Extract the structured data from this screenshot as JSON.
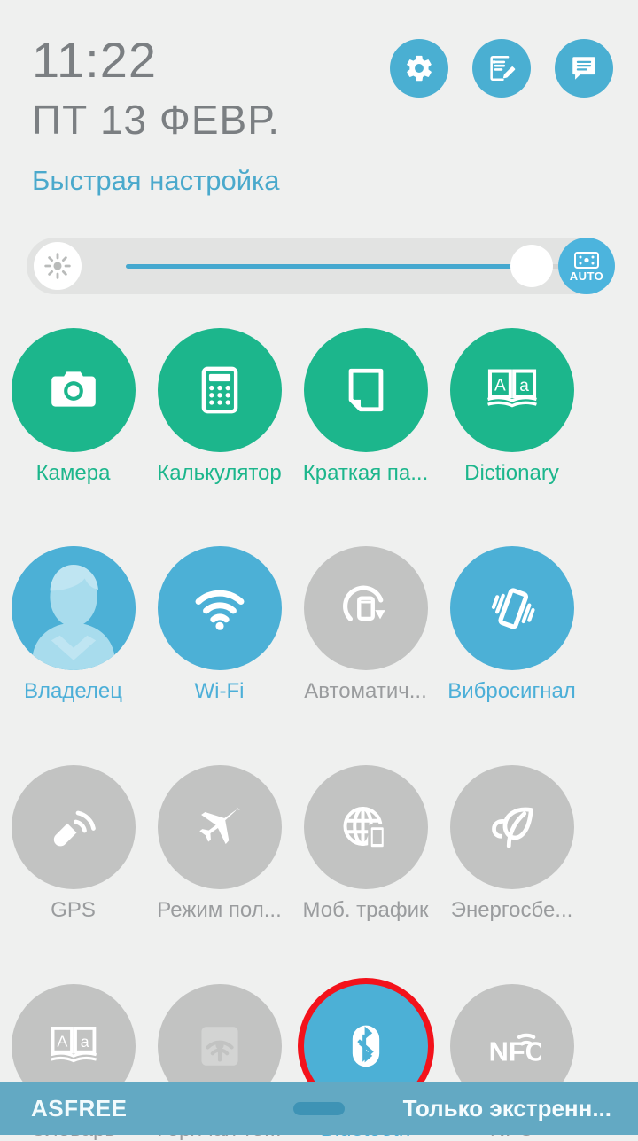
{
  "statusbar": {
    "time": "11:22",
    "date": "ПТ 13 ФЕВР.",
    "panel_title": "Быстрая настройка",
    "header_buttons": [
      {
        "name": "settings-icon",
        "label": "gear-icon"
      },
      {
        "name": "quick-note-icon",
        "label": "note-edit-icon"
      },
      {
        "name": "notifications-icon",
        "label": "chat-list-icon"
      }
    ]
  },
  "brightness": {
    "left_icon": "brightness-sun-icon",
    "value_percent": 89,
    "auto_label": "AUTO",
    "auto_icon": "light-sensor-icon",
    "auto_enabled": true
  },
  "tiles": [
    [
      {
        "label": "Камера",
        "icon": "camera-icon",
        "state": "app",
        "name": "tile-camera"
      },
      {
        "label": "Калькулятор",
        "icon": "calculator-icon",
        "state": "app",
        "name": "tile-calculator"
      },
      {
        "label": "Краткая па...",
        "icon": "quick-memo-icon",
        "state": "app",
        "name": "tile-quick-memo"
      },
      {
        "label": "Dictionary",
        "icon": "dictionary-book-icon",
        "state": "app",
        "name": "tile-dictionary-en"
      }
    ],
    [
      {
        "label": "Владелец",
        "icon": "user-avatar-icon",
        "state": "on",
        "name": "tile-owner"
      },
      {
        "label": "Wi-Fi",
        "icon": "wifi-icon",
        "state": "on",
        "name": "tile-wifi"
      },
      {
        "label": "Автоматич...",
        "icon": "auto-rotate-icon",
        "state": "off",
        "name": "tile-auto-rotate"
      },
      {
        "label": "Вибросигнал",
        "icon": "vibrate-icon",
        "state": "on",
        "name": "tile-vibrate"
      }
    ],
    [
      {
        "label": "GPS",
        "icon": "gps-satellite-icon",
        "state": "off",
        "name": "tile-gps"
      },
      {
        "label": "Режим пол...",
        "icon": "airplane-icon",
        "state": "off",
        "name": "tile-airplane-mode"
      },
      {
        "label": "Моб. трафик",
        "icon": "mobile-data-icon",
        "state": "off",
        "name": "tile-mobile-data"
      },
      {
        "label": "Энергосбе...",
        "icon": "leaf-power-saving-icon",
        "state": "off",
        "name": "tile-power-saving"
      }
    ],
    [
      {
        "label": "Словарь",
        "icon": "dictionary-book-icon",
        "state": "off",
        "name": "tile-dictionary-ru"
      },
      {
        "label": "Горячая то...",
        "icon": "hotspot-icon",
        "state": "off",
        "name": "tile-hotspot"
      },
      {
        "label": "Bluetooth",
        "icon": "bluetooth-icon",
        "state": "on",
        "name": "tile-bluetooth",
        "highlighted": true
      },
      {
        "label": "NFC",
        "icon": "nfc-icon",
        "state": "off",
        "name": "tile-nfc"
      }
    ]
  ],
  "bottombar": {
    "carrier": "ASFREE",
    "status": "Только экстренн..."
  },
  "colors": {
    "accent_blue": "#4cb0d6",
    "app_green": "#1cb68c",
    "off_gray": "#c2c3c2",
    "highlight_red": "#f3121b",
    "background": "#eff0ef",
    "bottom_bar": "#63a9c3"
  }
}
